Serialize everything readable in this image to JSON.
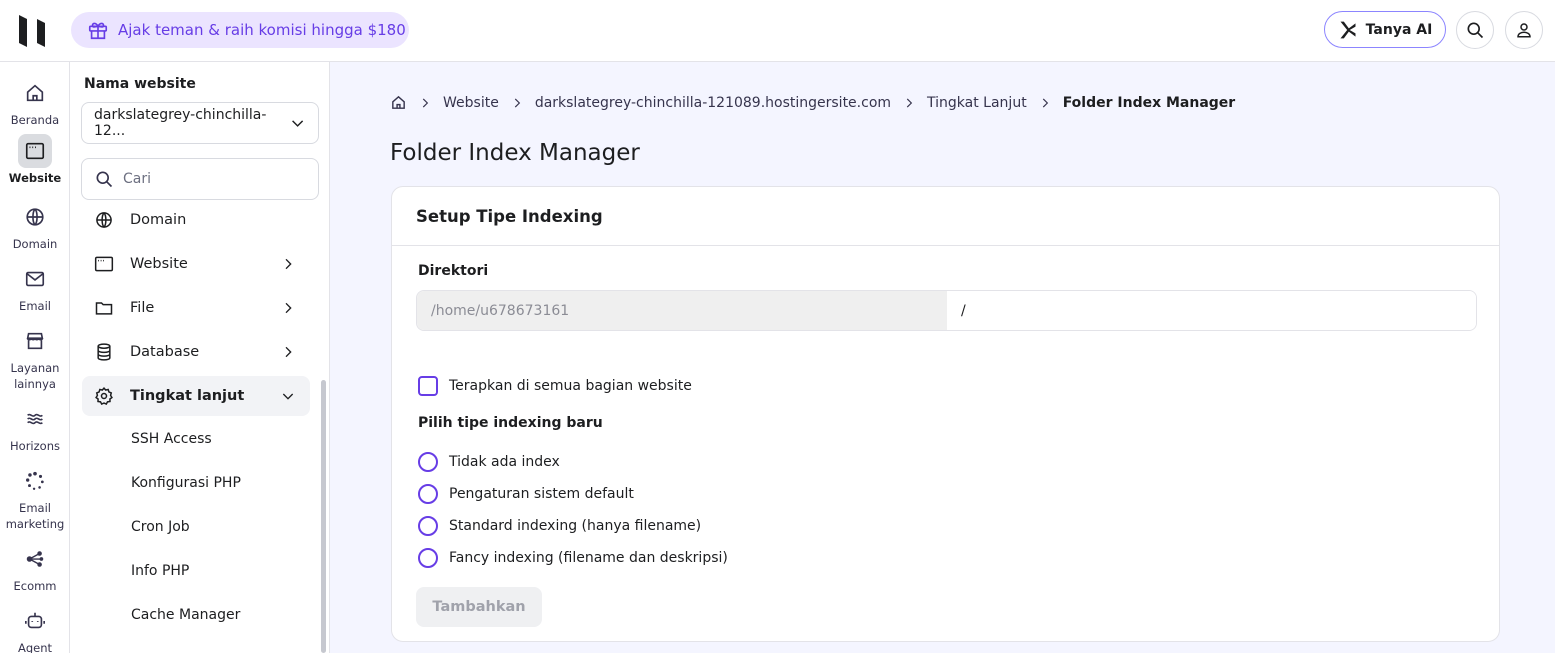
{
  "topbar": {
    "promo_text": "Ajak teman & raih komisi hingga $180",
    "ai_button": "Tanya AI",
    "icons": [
      "hostinger-logo",
      "gift-icon",
      "ai-spark-icon",
      "search-icon",
      "user-icon"
    ]
  },
  "rail": {
    "items": [
      {
        "label": "Beranda",
        "icon": "home-icon"
      },
      {
        "label": "Website",
        "icon": "browser-icon",
        "active": true
      },
      {
        "label": "Domain",
        "icon": "globe-icon"
      },
      {
        "label": "Email",
        "icon": "mail-icon"
      },
      {
        "label": "Layanan lainnya",
        "icon": "store-icon"
      },
      {
        "label": "Horizons",
        "icon": "horizons-icon"
      },
      {
        "label": "Email marketing",
        "icon": "loader-icon"
      },
      {
        "label": "Ecomm",
        "icon": "share-nodes-icon"
      },
      {
        "label": "Agent",
        "icon": "robot-icon"
      }
    ]
  },
  "sidebar": {
    "title": "Nama website",
    "site_value": "darkslategrey-chinchilla-12...",
    "search_placeholder": "Cari",
    "nav": [
      {
        "label": "Domain",
        "icon": "globe-icon"
      },
      {
        "label": "Website",
        "icon": "browser-icon",
        "chevron": "right"
      },
      {
        "label": "File",
        "icon": "folder-icon",
        "chevron": "right"
      },
      {
        "label": "Database",
        "icon": "database-icon",
        "chevron": "right"
      },
      {
        "label": "Tingkat lanjut",
        "icon": "gear-icon",
        "chevron": "down",
        "open": true
      }
    ],
    "sub": [
      "SSH Access",
      "Konfigurasi PHP",
      "Cron Job",
      "Info PHP",
      "Cache Manager"
    ]
  },
  "breadcrumb": [
    "Website",
    "darkslategrey-chinchilla-121089.hostingersite.com",
    "Tingkat Lanjut",
    "Folder Index Manager"
  ],
  "page_title": "Folder Index Manager",
  "card": {
    "title": "Setup Tipe Indexing",
    "dir_label": "Direktori",
    "dir_prefix": "/home/u678673161",
    "dir_value": "/",
    "apply_all": "Terapkan di semua bagian website",
    "choose_label": "Pilih tipe indexing baru",
    "options": [
      "Tidak ada index",
      "Pengaturan sistem default",
      "Standard indexing (hanya filename)",
      "Fancy indexing (filename dan deskripsi)"
    ],
    "submit": "Tambahkan"
  },
  "colors": {
    "accent": "#673de6",
    "promo_bg": "#ebe4ff",
    "page_bg": "#f4f5ff"
  }
}
